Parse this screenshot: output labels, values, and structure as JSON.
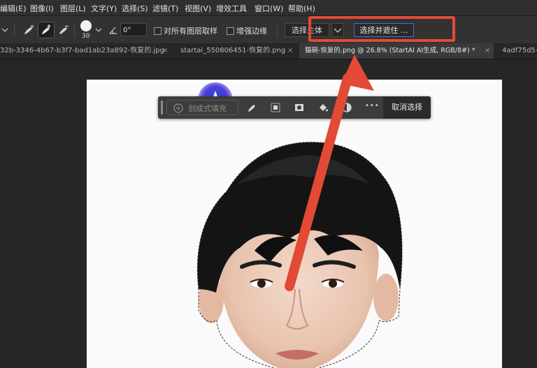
{
  "menubar": {
    "items": [
      {
        "label": "编辑(E)"
      },
      {
        "label": "图像(I)"
      },
      {
        "label": "图层(L)"
      },
      {
        "label": "文字(Y)"
      },
      {
        "label": "选择(S)"
      },
      {
        "label": "滤镜(T)"
      },
      {
        "label": "视图(V)"
      },
      {
        "label": "增效工具"
      },
      {
        "label": "窗口(W)"
      },
      {
        "label": "帮助(H)"
      }
    ]
  },
  "options": {
    "brush_size": "30",
    "angle": "0°",
    "sample_all_layers_label": "对所有图层取样",
    "enhance_edge_label": "增强边缘",
    "select_subject_label": "选择主体",
    "select_and_mask_label": "选择并遮住 ..."
  },
  "tabs": [
    {
      "label": "32b-3346-4b67-b3f7-bad1ab23a892-恢复的.jpg",
      "close": "×"
    },
    {
      "label": "startai_550806451-恢复的.png",
      "close": "×"
    },
    {
      "label": "猫碗-恢复的.png @ 26.8% (StartAI AI生成, RGB/8#) *",
      "close": "×"
    },
    {
      "label": "4adf75d5-",
      "close": ""
    }
  ],
  "contextbar": {
    "generative_fill_label": "创成式填充",
    "more_label": "•••",
    "deselect_label": "取消选择"
  },
  "colors": {
    "accent": "#3d74d6",
    "annotation_red": "#e24a36"
  }
}
